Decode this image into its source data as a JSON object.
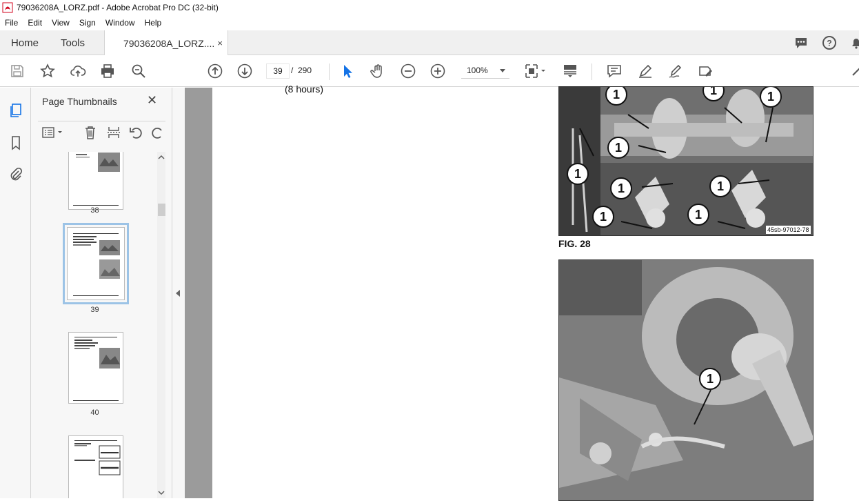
{
  "window": {
    "title": "79036208A_LORZ.pdf - Adobe Acrobat Pro DC (32-bit)"
  },
  "menu": [
    "File",
    "Edit",
    "View",
    "Sign",
    "Window",
    "Help"
  ],
  "tabs": {
    "home": "Home",
    "tools": "Tools",
    "document": "79036208A_LORZ....",
    "close": "×"
  },
  "toolbar": {
    "current_page": "39",
    "separator": "/",
    "total_pages": "290",
    "zoom": "100%"
  },
  "panel": {
    "title": "Page Thumbnails",
    "close": "✕",
    "thumbnails": [
      {
        "label": "38"
      },
      {
        "label": "39",
        "selected": true
      },
      {
        "label": "40"
      }
    ]
  },
  "document": {
    "text": "(8 hours)",
    "figures": [
      {
        "caption": "FIG. 28",
        "code": "45sb-97012-78",
        "callouts": [
          "1",
          "1",
          "1",
          "1",
          "1",
          "1",
          "1",
          "1",
          "1"
        ]
      },
      {
        "caption": "",
        "code": "",
        "callouts": [
          "1"
        ]
      }
    ]
  },
  "colors": {
    "accent_blue": "#1473e6",
    "panel_bg": "#f7f7f7",
    "doc_bg": "#9b9b9b"
  }
}
